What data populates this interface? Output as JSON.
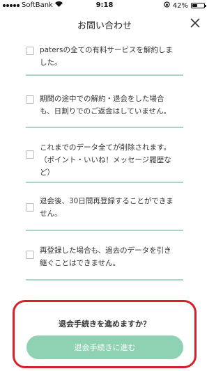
{
  "status_bar": {
    "carrier": "SoftBank",
    "time": "9:18",
    "battery": "42%",
    "battery_level": 0.42
  },
  "header": {
    "title": "お問い合わせ"
  },
  "items": [
    {
      "text": "patersの全ての有料サービスを解約しま\nした。"
    },
    {
      "text": "期間の途中での解約・退会をした場合\nも、日割りでのご返金はしていません。"
    },
    {
      "text": "これまでのデータ全てが削除されます。\n（ポイント・いいね！メッセージ履歴な\nど）"
    },
    {
      "text": "退会後、30日間再登録することができま\nせん。"
    },
    {
      "text": "再登録した場合も、過去のデータを引き\n継ぐことはできません。"
    }
  ],
  "confirm": {
    "question": "退会手続きを進めますか？",
    "button_label": "退会手続きに進む"
  }
}
